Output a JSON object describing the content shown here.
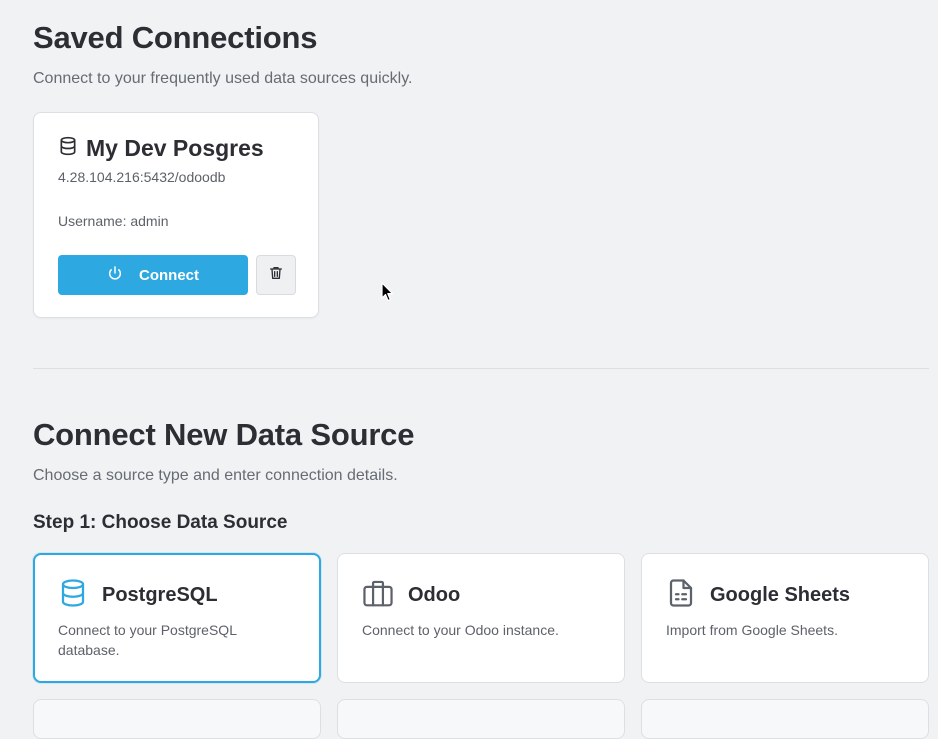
{
  "saved": {
    "title": "Saved Connections",
    "subtitle": "Connect to your frequently used data sources quickly.",
    "connections": [
      {
        "name": "My Dev Posgres",
        "host": "4.28.104.216:5432/odoodb",
        "username_text": "Username: admin",
        "connect_label": "Connect",
        "icon": "database-icon"
      }
    ]
  },
  "new_source": {
    "title": "Connect New Data Source",
    "subtitle": "Choose a source type and enter connection details.",
    "step_label": "Step 1: Choose Data Source",
    "sources": [
      {
        "name": "PostgreSQL",
        "description": "Connect to your PostgreSQL database.",
        "icon": "database-icon",
        "selected": true
      },
      {
        "name": "Odoo",
        "description": "Connect to your Odoo instance.",
        "icon": "briefcase-icon",
        "selected": false
      },
      {
        "name": "Google Sheets",
        "description": "Import from Google Sheets.",
        "icon": "spreadsheet-file-icon",
        "selected": false
      }
    ]
  },
  "colors": {
    "accent": "#2ea8e0",
    "background": "#f1f2f4",
    "card": "#ffffff"
  }
}
